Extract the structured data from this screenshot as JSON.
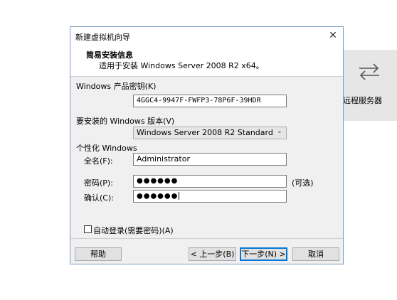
{
  "background_panel": {
    "label": "远程服务器",
    "icon": "arrows-exchange-icon"
  },
  "dialog": {
    "title": "新建虚拟机向导",
    "close_icon": "close-icon",
    "header": {
      "title": "简易安装信息",
      "subtitle": "适用于安装 Windows Server 2008 R2 x64。"
    },
    "product_key": {
      "label": "Windows 产品密钥(K)",
      "value": "4GGC4-9947F-FWFP3-78P6F-39HDR"
    },
    "version": {
      "label": "要安装的 Windows 版本(V)",
      "selected": "Windows Server 2008 R2 Standard"
    },
    "personalize": {
      "label": "个性化 Windows",
      "fullname_label": "全名(F):",
      "fullname_value": "Administrator",
      "password_label": "密码(P):",
      "password_value": "●●●●●●",
      "optional_label": "(可选)",
      "confirm_label": "确认(C):",
      "confirm_value": "●●●●●●"
    },
    "autologin_label": "自动登录(需要密码)(A)",
    "buttons": {
      "help": "帮助",
      "back": "< 上一步(B)",
      "next": "下一步(N) >",
      "cancel": "取消"
    }
  },
  "colors": {
    "dialog_bg": "#f0f0f0",
    "primary_border": "#0078d7",
    "side_panel": "#e6e6e6"
  }
}
